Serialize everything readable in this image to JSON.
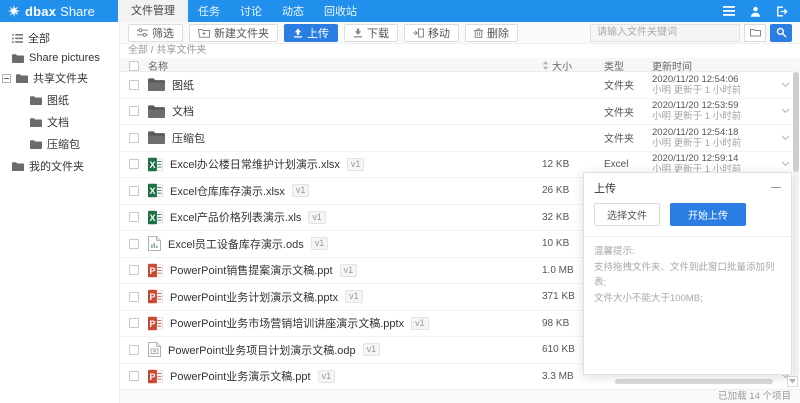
{
  "header": {
    "logo": {
      "bold": "dbax",
      "light": "Share"
    },
    "tabs": {
      "active": "文件管理"
    },
    "nav_items": [
      "任务",
      "讨论",
      "动态",
      "回收站"
    ]
  },
  "sidebar": {
    "items": [
      {
        "key": "all",
        "label": "全部",
        "icon": "list-icon",
        "indent": 0,
        "expander": false
      },
      {
        "key": "share-pictures",
        "label": "Share pictures",
        "icon": "folder-icon",
        "indent": 0,
        "expander": false
      },
      {
        "key": "shared-folders",
        "label": "共享文件夹",
        "icon": "folder-icon",
        "indent": 0,
        "expander": true
      },
      {
        "key": "drawings",
        "label": "图纸",
        "icon": "folder-icon",
        "indent": 1,
        "expander": false
      },
      {
        "key": "documents",
        "label": "文档",
        "icon": "folder-icon",
        "indent": 1,
        "expander": false
      },
      {
        "key": "archives",
        "label": "压缩包",
        "icon": "folder-icon",
        "indent": 1,
        "expander": false
      },
      {
        "key": "my-folders",
        "label": "我的文件夹",
        "icon": "folder-icon",
        "indent": 0,
        "expander": false
      }
    ]
  },
  "toolbar": {
    "buttons": [
      {
        "key": "filter",
        "label": "筛选",
        "icon": "filter-icon",
        "primary": false
      },
      {
        "key": "new-folder",
        "label": "新建文件夹",
        "icon": "new-folder-icon",
        "primary": false
      },
      {
        "key": "upload",
        "label": "上传",
        "icon": "upload-icon",
        "primary": true
      },
      {
        "key": "download",
        "label": "下载",
        "icon": "download-icon",
        "primary": false
      },
      {
        "key": "move",
        "label": "移动",
        "icon": "move-icon",
        "primary": false
      },
      {
        "key": "delete",
        "label": "删除",
        "icon": "delete-icon",
        "primary": false
      }
    ],
    "search_placeholder": "请输入文件关键词"
  },
  "breadcrumb": "全部 / 共享文件夹",
  "table": {
    "headers": {
      "name": "名称",
      "size": "大小",
      "type": "类型",
      "updated": "更新时间"
    },
    "rows": [
      {
        "icon": "folder-icon",
        "name": "图纸",
        "version": "",
        "size": "",
        "type": "文件夹",
        "updated": "2020/11/20 12:54:06",
        "updated_by": "小明 更新于 1 小时前"
      },
      {
        "icon": "folder-icon",
        "name": "文档",
        "version": "",
        "size": "",
        "type": "文件夹",
        "updated": "2020/11/20 12:53:59",
        "updated_by": "小明 更新于 1 小时前"
      },
      {
        "icon": "folder-icon",
        "name": "压缩包",
        "version": "",
        "size": "",
        "type": "文件夹",
        "updated": "2020/11/20 12:54:18",
        "updated_by": "小明 更新于 1 小时前"
      },
      {
        "icon": "excel-file-icon",
        "name": "Excel办公楼日常维护计划演示.xlsx",
        "version": "v1",
        "size": "12 KB",
        "type": "Excel",
        "updated": "2020/11/20 12:59:14",
        "updated_by": "小明 更新于 1 小时前"
      },
      {
        "icon": "excel-file-icon",
        "name": "Excel仓库库存演示.xlsx",
        "version": "v1",
        "size": "26 KB",
        "type": "",
        "updated": "",
        "updated_by": ""
      },
      {
        "icon": "excel-file-icon",
        "name": "Excel产品价格列表演示.xls",
        "version": "v1",
        "size": "32 KB",
        "type": "",
        "updated": "",
        "updated_by": ""
      },
      {
        "icon": "ods-file-icon",
        "name": "Excel员工设备库存演示.ods",
        "version": "v1",
        "size": "10 KB",
        "type": "",
        "updated": "",
        "updated_by": ""
      },
      {
        "icon": "ppt-file-icon",
        "name": "PowerPoint销售提案演示文稿.ppt",
        "version": "v1",
        "size": "1.0 MB",
        "type": "",
        "updated": "",
        "updated_by": ""
      },
      {
        "icon": "ppt-file-icon",
        "name": "PowerPoint业务计划演示文稿.pptx",
        "version": "v1",
        "size": "371 KB",
        "type": "",
        "updated": "",
        "updated_by": ""
      },
      {
        "icon": "ppt-file-icon",
        "name": "PowerPoint业务市场营销培训讲座演示文稿.pptx",
        "version": "v1",
        "size": "98 KB",
        "type": "",
        "updated": "",
        "updated_by": ""
      },
      {
        "icon": "odp-file-icon",
        "name": "PowerPoint业务项目计划演示文稿.odp",
        "version": "v1",
        "size": "610 KB",
        "type": "",
        "updated": "",
        "updated_by": ""
      },
      {
        "icon": "ppt-file-icon",
        "name": "PowerPoint业务演示文稿.ppt",
        "version": "v1",
        "size": "3.3 MB",
        "type": "",
        "updated": "",
        "updated_by": ""
      }
    ]
  },
  "upload_panel": {
    "title": "上传",
    "choose_file": "选择文件",
    "start_upload": "开始上传",
    "tips_title": "温馨提示:",
    "tip1": "支持拖拽文件夹、文件到此窗口批量添加列表;",
    "tip2": "文件大小不能大于100MB;"
  },
  "status_bar": {
    "loaded_text": "已加载 14 个项目"
  },
  "colors": {
    "header_blue": "#2190ED",
    "primary_blue": "#2A7DE2",
    "excel_green": "#1E7145",
    "ppt_orange": "#C74B32"
  }
}
